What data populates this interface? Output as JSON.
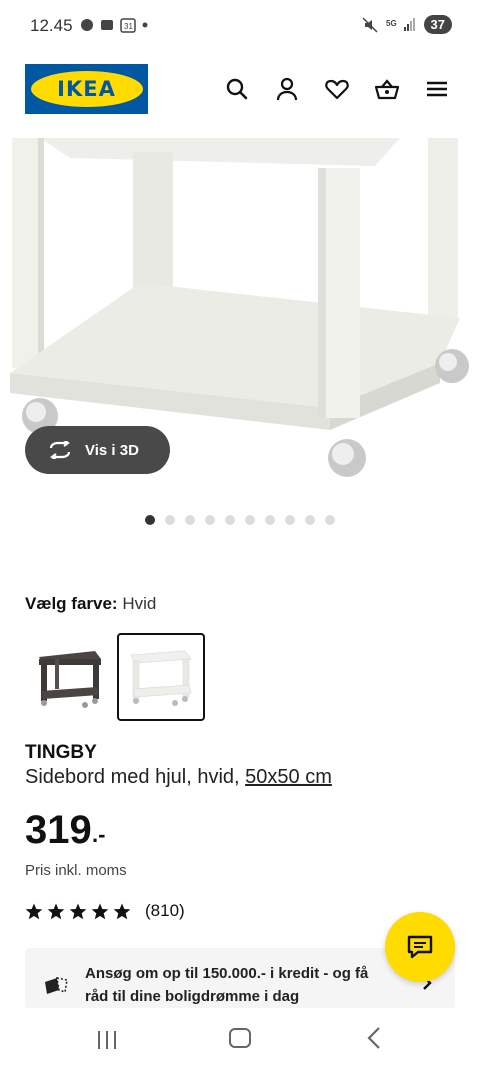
{
  "status_bar": {
    "time": "12.45",
    "battery": "37"
  },
  "header": {
    "logo_text": "IKEA",
    "icons": [
      "search-icon",
      "account-icon",
      "heart-icon",
      "basket-icon",
      "menu-icon"
    ]
  },
  "gallery": {
    "view_3d_label": "Vis i 3D",
    "dot_count": 10,
    "active_dot": 0
  },
  "color": {
    "label": "Vælg farve:",
    "value": "Hvid"
  },
  "product": {
    "name": "TINGBY",
    "description": "Sidebord med hjul, hvid, ",
    "size_link": "50x50 cm",
    "price": "319",
    "price_suffix": ".-",
    "vat_note": "Pris inkl. moms",
    "rating_count": "(810)",
    "stars": 5
  },
  "credit": {
    "text": "Ansøg om op til 150.000.- i kredit - og få råd til dine boligdrømme i dag"
  },
  "colors": {
    "ikea_blue": "#0058a3",
    "ikea_yellow": "#ffdb00",
    "pill_bg": "#494949"
  }
}
